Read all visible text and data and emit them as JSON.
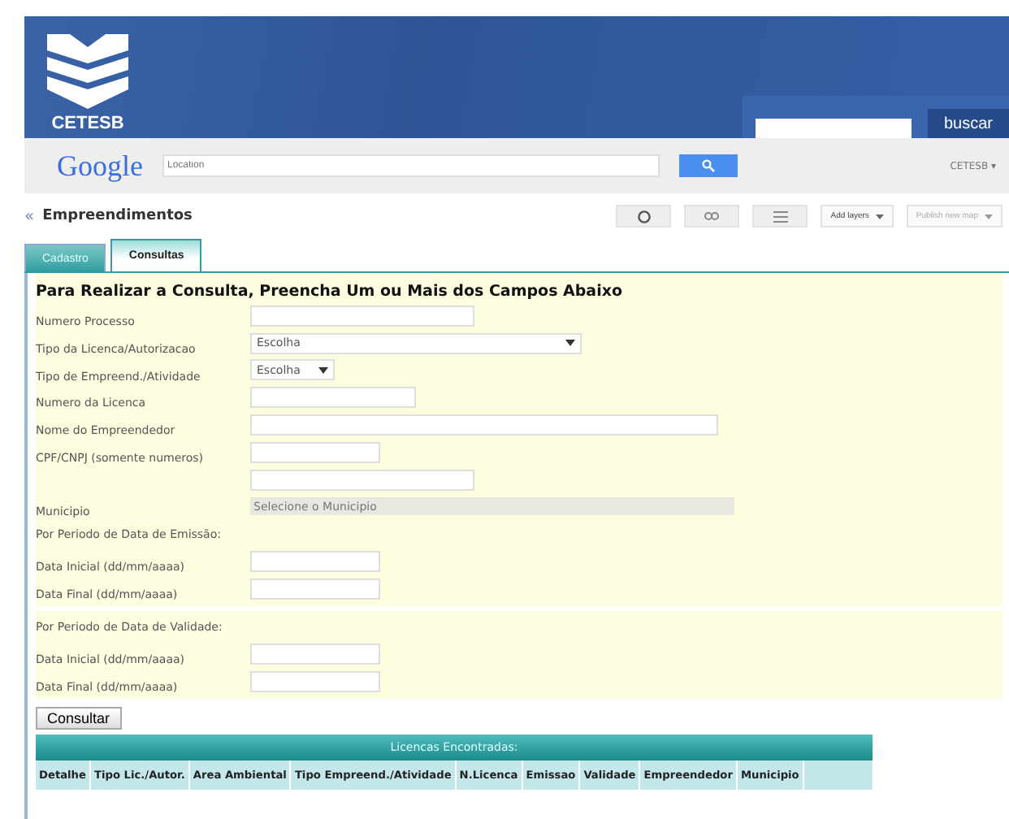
{
  "header": {
    "logo_text": "CETESB",
    "search_button": "buscar"
  },
  "google_bar": {
    "logo": "Google",
    "search": {
      "placeholder": "Location"
    },
    "account": "CETESB ▾"
  },
  "map_bar": {
    "collapse": "«",
    "title": "Empreendimentos",
    "add_layers": "Add layers",
    "publish": "Publish new map"
  },
  "tabs": [
    {
      "label": "Cadastro",
      "selected": false
    },
    {
      "label": "Consultas",
      "selected": true
    }
  ],
  "form": {
    "heading": "Para Realizar a Consulta, Preencha Um ou Mais dos Campos Abaixo",
    "rows": [
      {
        "kind": "text",
        "label": "Numero Processo"
      },
      {
        "kind": "select",
        "label": "Tipo da Licenca/Autorizacao",
        "value": "Escolha"
      },
      {
        "kind": "select",
        "label": "Tipo de Empreend./Atividade",
        "value": "Escolha"
      },
      {
        "kind": "text",
        "label": "Numero da Licenca"
      },
      {
        "kind": "text",
        "label": "Nome do Empreendedor"
      },
      {
        "kind": "text",
        "label": "CPF/CNPJ (somente numeros)"
      },
      {
        "kind": "text",
        "label": ""
      },
      {
        "kind": "combo",
        "label": "Municipio",
        "value": "Selecione o Municipio"
      },
      {
        "kind": "section",
        "label": "Por Periodo de Data de Emissão:"
      },
      {
        "kind": "text",
        "label": "Data Inicial (dd/mm/aaaa)"
      },
      {
        "kind": "text",
        "label": "Data Final (dd/mm/aaaa)"
      },
      {
        "kind": "gap"
      },
      {
        "kind": "section",
        "label": "Por Periodo de Data de Validade:"
      },
      {
        "kind": "text",
        "label": "Data Inicial (dd/mm/aaaa)"
      },
      {
        "kind": "text",
        "label": "Data Final (dd/mm/aaaa)"
      }
    ],
    "submit": "Consultar"
  },
  "results": {
    "title": "Licencas Encontradas:",
    "columns": [
      "Detalhe",
      "Tipo Lic./Autor.",
      "Area Ambiental",
      "Tipo Empreend./Atividade",
      "N.Licenca",
      "Emissao",
      "Validade",
      "Empreendedor",
      "Municipio"
    ]
  }
}
